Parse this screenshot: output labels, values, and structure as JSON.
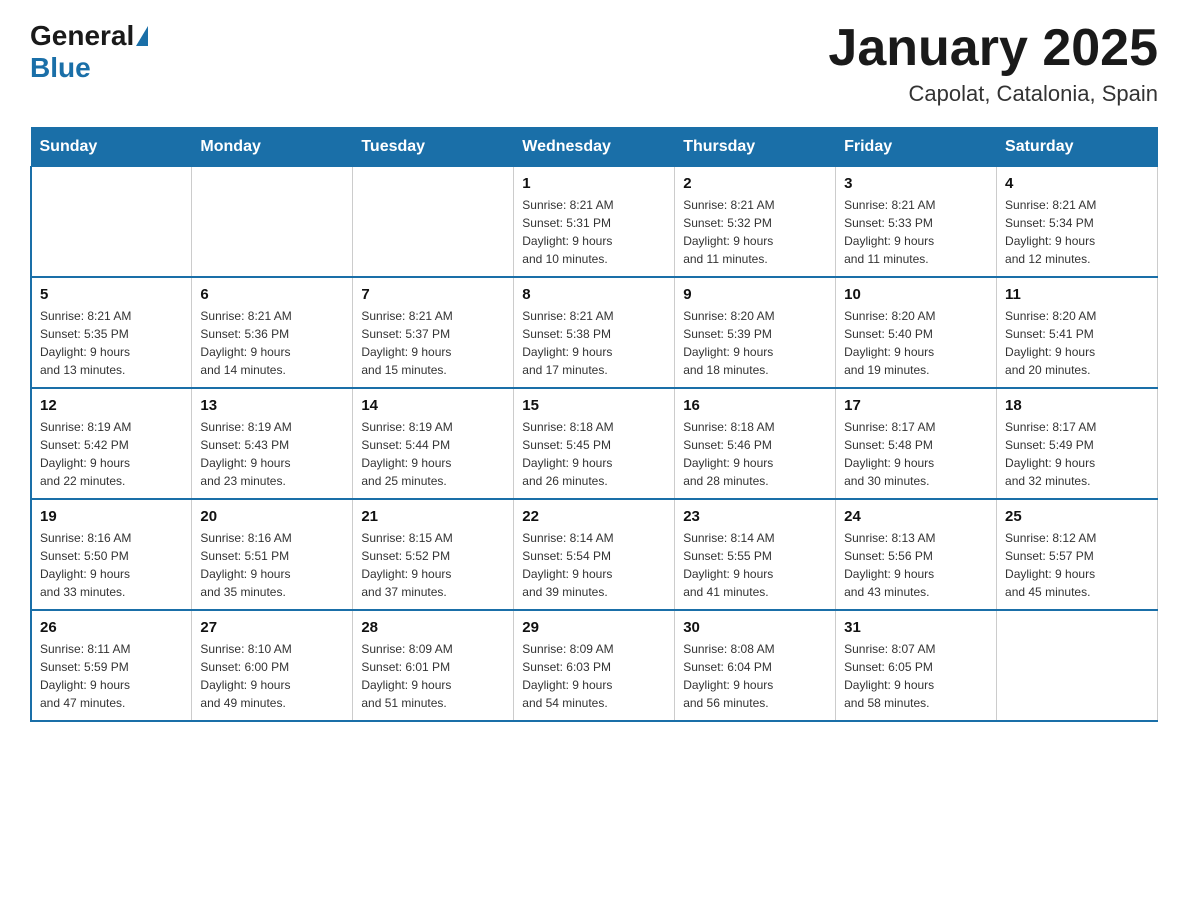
{
  "header": {
    "logo_general": "General",
    "logo_blue": "Blue",
    "title": "January 2025",
    "subtitle": "Capolat, Catalonia, Spain"
  },
  "days_of_week": [
    "Sunday",
    "Monday",
    "Tuesday",
    "Wednesday",
    "Thursday",
    "Friday",
    "Saturday"
  ],
  "weeks": [
    [
      {
        "day": "",
        "info": ""
      },
      {
        "day": "",
        "info": ""
      },
      {
        "day": "",
        "info": ""
      },
      {
        "day": "1",
        "info": "Sunrise: 8:21 AM\nSunset: 5:31 PM\nDaylight: 9 hours\nand 10 minutes."
      },
      {
        "day": "2",
        "info": "Sunrise: 8:21 AM\nSunset: 5:32 PM\nDaylight: 9 hours\nand 11 minutes."
      },
      {
        "day": "3",
        "info": "Sunrise: 8:21 AM\nSunset: 5:33 PM\nDaylight: 9 hours\nand 11 minutes."
      },
      {
        "day": "4",
        "info": "Sunrise: 8:21 AM\nSunset: 5:34 PM\nDaylight: 9 hours\nand 12 minutes."
      }
    ],
    [
      {
        "day": "5",
        "info": "Sunrise: 8:21 AM\nSunset: 5:35 PM\nDaylight: 9 hours\nand 13 minutes."
      },
      {
        "day": "6",
        "info": "Sunrise: 8:21 AM\nSunset: 5:36 PM\nDaylight: 9 hours\nand 14 minutes."
      },
      {
        "day": "7",
        "info": "Sunrise: 8:21 AM\nSunset: 5:37 PM\nDaylight: 9 hours\nand 15 minutes."
      },
      {
        "day": "8",
        "info": "Sunrise: 8:21 AM\nSunset: 5:38 PM\nDaylight: 9 hours\nand 17 minutes."
      },
      {
        "day": "9",
        "info": "Sunrise: 8:20 AM\nSunset: 5:39 PM\nDaylight: 9 hours\nand 18 minutes."
      },
      {
        "day": "10",
        "info": "Sunrise: 8:20 AM\nSunset: 5:40 PM\nDaylight: 9 hours\nand 19 minutes."
      },
      {
        "day": "11",
        "info": "Sunrise: 8:20 AM\nSunset: 5:41 PM\nDaylight: 9 hours\nand 20 minutes."
      }
    ],
    [
      {
        "day": "12",
        "info": "Sunrise: 8:19 AM\nSunset: 5:42 PM\nDaylight: 9 hours\nand 22 minutes."
      },
      {
        "day": "13",
        "info": "Sunrise: 8:19 AM\nSunset: 5:43 PM\nDaylight: 9 hours\nand 23 minutes."
      },
      {
        "day": "14",
        "info": "Sunrise: 8:19 AM\nSunset: 5:44 PM\nDaylight: 9 hours\nand 25 minutes."
      },
      {
        "day": "15",
        "info": "Sunrise: 8:18 AM\nSunset: 5:45 PM\nDaylight: 9 hours\nand 26 minutes."
      },
      {
        "day": "16",
        "info": "Sunrise: 8:18 AM\nSunset: 5:46 PM\nDaylight: 9 hours\nand 28 minutes."
      },
      {
        "day": "17",
        "info": "Sunrise: 8:17 AM\nSunset: 5:48 PM\nDaylight: 9 hours\nand 30 minutes."
      },
      {
        "day": "18",
        "info": "Sunrise: 8:17 AM\nSunset: 5:49 PM\nDaylight: 9 hours\nand 32 minutes."
      }
    ],
    [
      {
        "day": "19",
        "info": "Sunrise: 8:16 AM\nSunset: 5:50 PM\nDaylight: 9 hours\nand 33 minutes."
      },
      {
        "day": "20",
        "info": "Sunrise: 8:16 AM\nSunset: 5:51 PM\nDaylight: 9 hours\nand 35 minutes."
      },
      {
        "day": "21",
        "info": "Sunrise: 8:15 AM\nSunset: 5:52 PM\nDaylight: 9 hours\nand 37 minutes."
      },
      {
        "day": "22",
        "info": "Sunrise: 8:14 AM\nSunset: 5:54 PM\nDaylight: 9 hours\nand 39 minutes."
      },
      {
        "day": "23",
        "info": "Sunrise: 8:14 AM\nSunset: 5:55 PM\nDaylight: 9 hours\nand 41 minutes."
      },
      {
        "day": "24",
        "info": "Sunrise: 8:13 AM\nSunset: 5:56 PM\nDaylight: 9 hours\nand 43 minutes."
      },
      {
        "day": "25",
        "info": "Sunrise: 8:12 AM\nSunset: 5:57 PM\nDaylight: 9 hours\nand 45 minutes."
      }
    ],
    [
      {
        "day": "26",
        "info": "Sunrise: 8:11 AM\nSunset: 5:59 PM\nDaylight: 9 hours\nand 47 minutes."
      },
      {
        "day": "27",
        "info": "Sunrise: 8:10 AM\nSunset: 6:00 PM\nDaylight: 9 hours\nand 49 minutes."
      },
      {
        "day": "28",
        "info": "Sunrise: 8:09 AM\nSunset: 6:01 PM\nDaylight: 9 hours\nand 51 minutes."
      },
      {
        "day": "29",
        "info": "Sunrise: 8:09 AM\nSunset: 6:03 PM\nDaylight: 9 hours\nand 54 minutes."
      },
      {
        "day": "30",
        "info": "Sunrise: 8:08 AM\nSunset: 6:04 PM\nDaylight: 9 hours\nand 56 minutes."
      },
      {
        "day": "31",
        "info": "Sunrise: 8:07 AM\nSunset: 6:05 PM\nDaylight: 9 hours\nand 58 minutes."
      },
      {
        "day": "",
        "info": ""
      }
    ]
  ]
}
